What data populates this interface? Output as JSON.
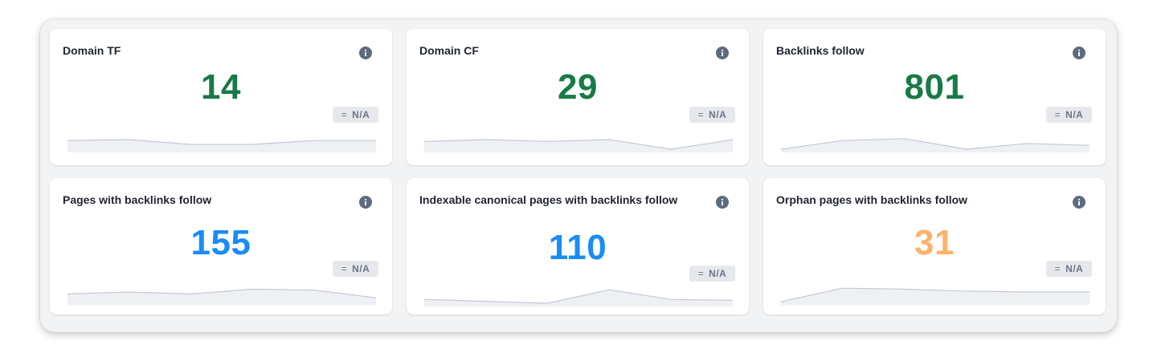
{
  "colors": {
    "green": "#187a46",
    "blue": "#1a8cf5",
    "orange": "#fbb26a",
    "spark_fill": "#eef0f3",
    "spark_line": "#c3c9d4",
    "info_icon": "#5e6a7e"
  },
  "cards": [
    {
      "title": "Domain TF",
      "value": "14",
      "delta": "N/A",
      "color": "green",
      "spark": [
        0.55,
        0.5,
        0.75,
        0.75,
        0.55,
        0.55
      ]
    },
    {
      "title": "Domain CF",
      "value": "29",
      "delta": "N/A",
      "color": "green",
      "spark": [
        0.6,
        0.5,
        0.6,
        0.5,
        1.0,
        0.5
      ]
    },
    {
      "title": "Backlinks follow",
      "value": "801",
      "delta": "N/A",
      "color": "green",
      "spark": [
        1.0,
        0.55,
        0.45,
        1.0,
        0.7,
        0.8
      ]
    },
    {
      "title": "Pages with backlinks follow",
      "value": "155",
      "delta": "N/A",
      "color": "blue",
      "spark": [
        0.6,
        0.5,
        0.6,
        0.35,
        0.4,
        0.8
      ]
    },
    {
      "title": "Indexable canonical pages with backlinks follow",
      "value": "110",
      "delta": "N/A",
      "color": "blue",
      "spark": [
        0.8,
        0.9,
        1.0,
        0.3,
        0.8,
        0.85
      ]
    },
    {
      "title": "Orphan pages with backlinks follow",
      "value": "31",
      "delta": "N/A",
      "color": "orange",
      "spark": [
        1.0,
        0.3,
        0.35,
        0.45,
        0.5,
        0.5
      ]
    }
  ],
  "delta_symbol": "="
}
